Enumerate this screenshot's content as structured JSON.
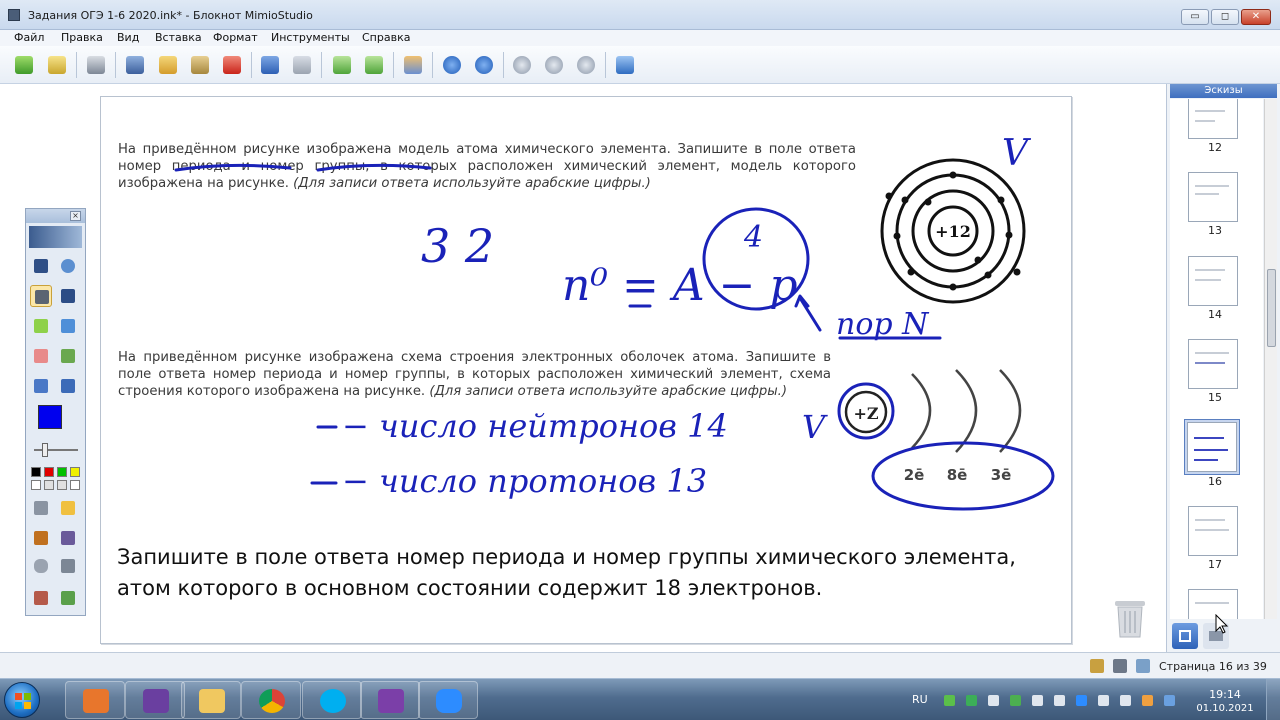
{
  "window": {
    "title": "Задания ОГЭ 1-6 2020.ink* - Блокнот MimioStudio",
    "controls": {
      "minimize": "▭",
      "maximize": "◻",
      "close": "✕"
    }
  },
  "menu": [
    "Файл",
    "Правка",
    "Вид",
    "Вставка",
    "Формат",
    "Инструменты",
    "Справка"
  ],
  "toolbar": {
    "icons": [
      "open-icon",
      "save-icon",
      "print-icon",
      "cut-icon",
      "copy-icon",
      "paste-icon",
      "delete-icon",
      "undo-icon",
      "redo-icon",
      "new-page-icon",
      "duplicate-page-icon",
      "users-icon",
      "prev-page-icon",
      "next-page-icon",
      "zoom-in-icon",
      "zoom-out-icon",
      "zoom-fit-icon",
      "screen-icon"
    ]
  },
  "page": {
    "task1_text": "На приведённом рисунке изображена модель атома химического элемента. Запишите в поле ответа номер периода и номер группы, в которых расположен химический элемент, модель которого изображена на рисунке.",
    "task1_note": "(Для записи ответа используйте арабские цифры.)",
    "atom_nucleus": "+12",
    "task2_text": "На приведённом рисунке изображена схема строения электронных оболочек атома. Запишите в поле ответа номер периода и номер группы, в которых расположен химический элемент, схема строения которого изображена на рисунке.",
    "task2_note": "(Для записи ответа используйте арабские цифры.)",
    "shell_nucleus": "+Z",
    "shells": [
      "2ē",
      "8ē",
      "3ē"
    ],
    "big_text": "Запишите в поле ответа номер периода и номер группы химического элемента, атом которого в основном состоянии содержит 18 электронов.",
    "handwriting": {
      "answer": "3 2",
      "particles": "n⁰ = A − p",
      "p_power": "4",
      "order_word": "пор N",
      "neutrons": "− число нейтронов 14",
      "protons": "− число протонов 13",
      "check1": "V",
      "check2": "V"
    }
  },
  "thumbnails": {
    "header": "Эскизы",
    "pages": [
      "12",
      "13",
      "14",
      "15",
      "16",
      "17"
    ],
    "active": "16"
  },
  "statusbar": {
    "page_info": "Страница 16 из 39"
  },
  "taskbar": {
    "apps": [
      "presentation-icon",
      "book-icon",
      "explorer-icon",
      "chrome-icon",
      "skype-icon",
      "mimio-icon",
      "zoom-icon"
    ],
    "language": "RU",
    "time": "19:14",
    "date": "01.10.2021"
  },
  "colors": {
    "ink": "#1a22b8",
    "titlebar": "#dfe9f5",
    "thumb_header": "#4a78c6",
    "taskbar": "#4f6c8e"
  }
}
